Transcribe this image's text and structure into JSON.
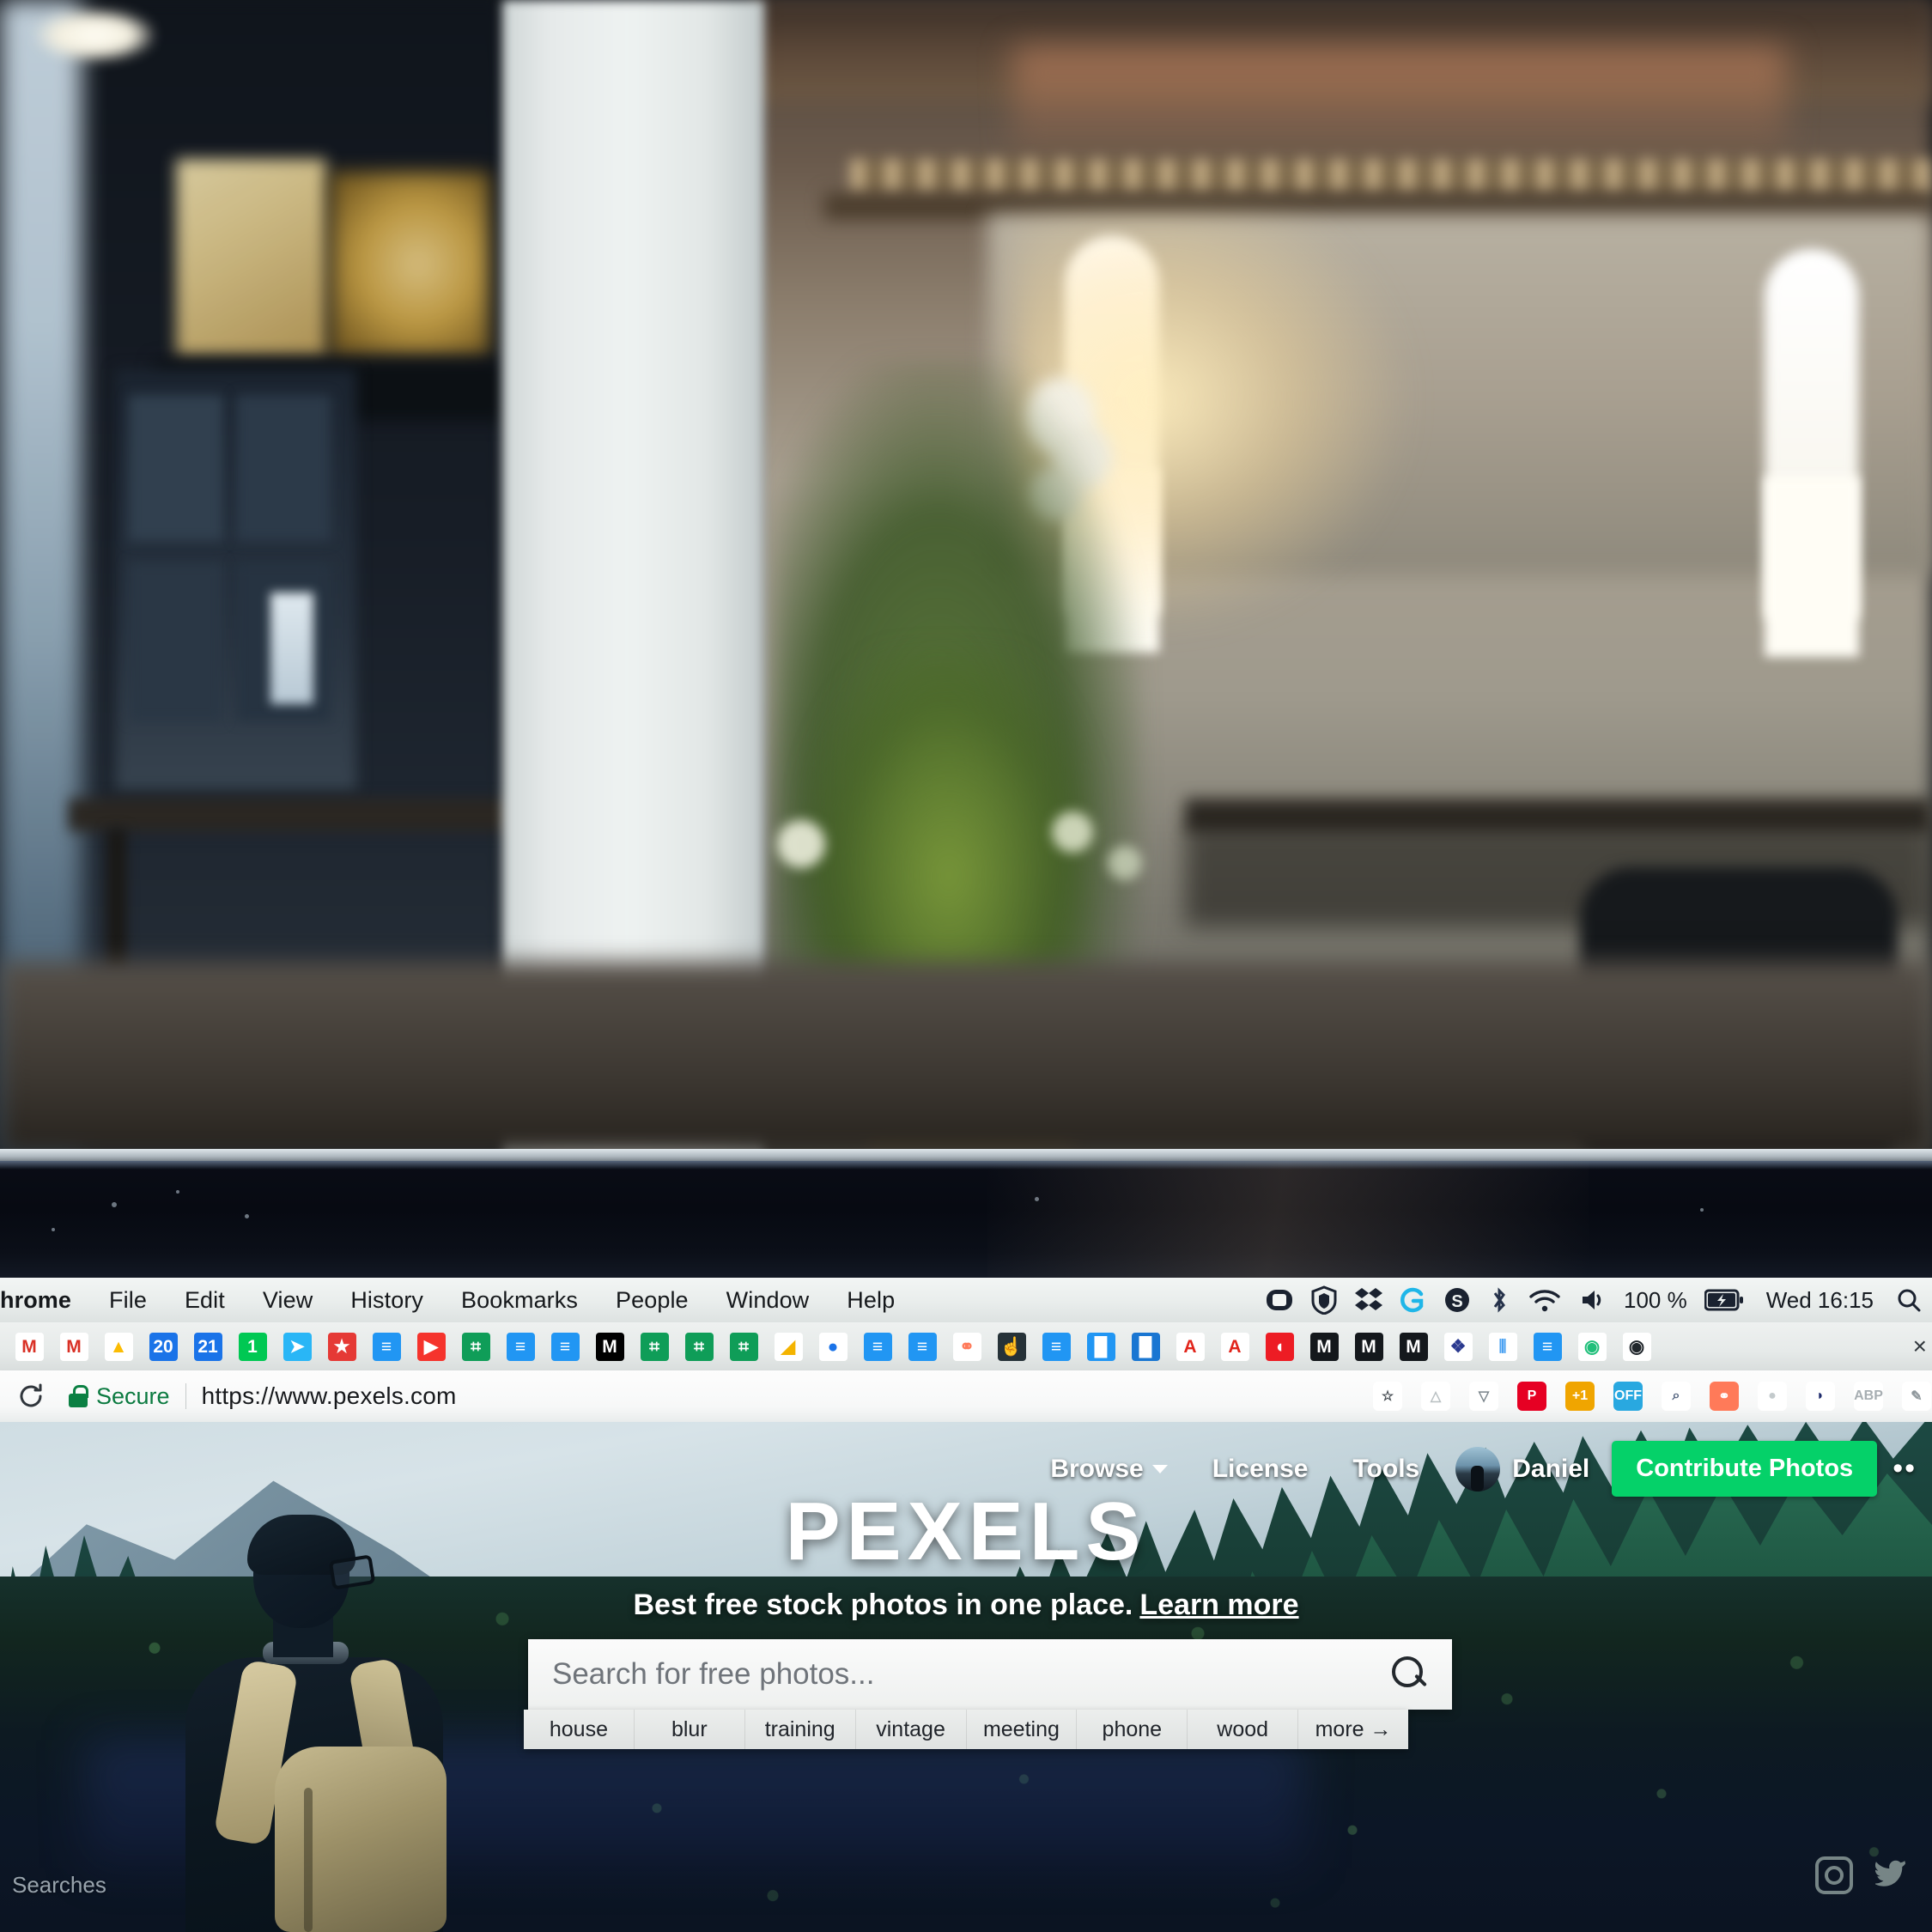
{
  "menubar": {
    "items": [
      "hrome",
      "File",
      "Edit",
      "View",
      "History",
      "Bookmarks",
      "People",
      "Window",
      "Help"
    ],
    "status": {
      "icons": [
        "display-icon",
        "vpn-shield-icon",
        "dropbox-icon",
        "logitech-g-icon",
        "skype-icon",
        "bluetooth-icon",
        "wifi-icon",
        "volume-icon"
      ],
      "battery_percent": "100 %",
      "battery_icon": "battery-charging-icon",
      "clock": "Wed 16:15",
      "spotlight_icon": "search-icon"
    }
  },
  "bookmarks": {
    "items": [
      {
        "name": "gmail",
        "glyph": "M",
        "bg": "#ffffff",
        "fg": "#d93025"
      },
      {
        "name": "gmail-2",
        "glyph": "M",
        "bg": "#ffffff",
        "fg": "#d93025"
      },
      {
        "name": "google-drive",
        "glyph": "▲",
        "bg": "#ffffff",
        "fg": "#fbbc04"
      },
      {
        "name": "google-calendar-20",
        "glyph": "20",
        "bg": "#1a73e8",
        "fg": "#ffffff"
      },
      {
        "name": "google-calendar-21",
        "glyph": "21",
        "bg": "#1a73e8",
        "fg": "#ffffff"
      },
      {
        "name": "evernote",
        "glyph": "1",
        "bg": "#00c853",
        "fg": "#ffffff"
      },
      {
        "name": "telegram",
        "glyph": "➤",
        "bg": "#29b6f6",
        "fg": "#ffffff"
      },
      {
        "name": "pocket-star",
        "glyph": "★",
        "bg": "#e53935",
        "fg": "#ffffff"
      },
      {
        "name": "google-docs",
        "glyph": "≡",
        "bg": "#2196f3",
        "fg": "#ffffff"
      },
      {
        "name": "youtube",
        "glyph": "▶",
        "bg": "#f5332c",
        "fg": "#ffffff"
      },
      {
        "name": "google-sheets",
        "glyph": "⌗",
        "bg": "#0f9d58",
        "fg": "#ffffff"
      },
      {
        "name": "google-docs-2",
        "glyph": "≡",
        "bg": "#2196f3",
        "fg": "#ffffff"
      },
      {
        "name": "google-docs-3",
        "glyph": "≡",
        "bg": "#2196f3",
        "fg": "#ffffff"
      },
      {
        "name": "medium",
        "glyph": "M",
        "bg": "#000000",
        "fg": "#ffffff"
      },
      {
        "name": "google-sheets-2",
        "glyph": "⌗",
        "bg": "#0f9d58",
        "fg": "#ffffff"
      },
      {
        "name": "google-sheets-3",
        "glyph": "⌗",
        "bg": "#0f9d58",
        "fg": "#ffffff"
      },
      {
        "name": "google-sheets-4",
        "glyph": "⌗",
        "bg": "#0f9d58",
        "fg": "#ffffff"
      },
      {
        "name": "analytics-yellow",
        "glyph": "◢",
        "bg": "#ffffff",
        "fg": "#f4b400"
      },
      {
        "name": "search-blue",
        "glyph": "●",
        "bg": "#ffffff",
        "fg": "#1a73e8"
      },
      {
        "name": "google-docs-4",
        "glyph": "≡",
        "bg": "#2196f3",
        "fg": "#ffffff"
      },
      {
        "name": "google-docs-5",
        "glyph": "≡",
        "bg": "#2196f3",
        "fg": "#ffffff"
      },
      {
        "name": "hubspot",
        "glyph": "⚭",
        "bg": "#ffffff",
        "fg": "#ff7a59"
      },
      {
        "name": "cursor-hand",
        "glyph": "☝",
        "bg": "#263238",
        "fg": "#ffffff"
      },
      {
        "name": "google-docs-6",
        "glyph": "≡",
        "bg": "#2196f3",
        "fg": "#ffffff"
      },
      {
        "name": "analytics-blue",
        "glyph": "█",
        "bg": "#2196f3",
        "fg": "#ffffff"
      },
      {
        "name": "analytics-blue-2",
        "glyph": "█",
        "bg": "#1976d2",
        "fg": "#ffffff"
      },
      {
        "name": "adobe-1",
        "glyph": "A",
        "bg": "#ffffff",
        "fg": "#e1251b"
      },
      {
        "name": "adobe-2",
        "glyph": "A",
        "bg": "#ffffff",
        "fg": "#e1251b"
      },
      {
        "name": "adobe-red",
        "glyph": "◖",
        "bg": "#ed1c24",
        "fg": "#ffffff"
      },
      {
        "name": "medium-2",
        "glyph": "M",
        "bg": "#14181c",
        "fg": "#ffffff"
      },
      {
        "name": "medium-3",
        "glyph": "M",
        "bg": "#14181c",
        "fg": "#ffffff"
      },
      {
        "name": "medium-4",
        "glyph": "M",
        "bg": "#14181c",
        "fg": "#ffffff"
      },
      {
        "name": "bird-blue",
        "glyph": "❖",
        "bg": "#ffffff",
        "fg": "#2b3a8f"
      },
      {
        "name": "steemit",
        "glyph": "⦀",
        "bg": "#ffffff",
        "fg": "#4ba2f2"
      },
      {
        "name": "google-docs-7",
        "glyph": "≡",
        "bg": "#2196f3",
        "fg": "#ffffff"
      },
      {
        "name": "aperture-green",
        "glyph": "◉",
        "bg": "#ffffff",
        "fg": "#1fbf7a"
      },
      {
        "name": "aperture-dark",
        "glyph": "◉",
        "bg": "#ffffff",
        "fg": "#20262b"
      }
    ],
    "overflow_label": "×"
  },
  "urlbar": {
    "reload_icon": "reload-icon",
    "security_label": "Secure",
    "url": "https://www.pexels.com",
    "extensions": [
      {
        "name": "bookmark-star-icon",
        "glyph": "☆",
        "bg": "#ffffff",
        "fg": "#40474d"
      },
      {
        "name": "google-drive-extension",
        "glyph": "△",
        "bg": "#ffffff",
        "fg": "#b9c0c2"
      },
      {
        "name": "pocket-extension",
        "glyph": "▽",
        "bg": "#ffffff",
        "fg": "#7b858c"
      },
      {
        "name": "pinterest-extension",
        "glyph": "P",
        "bg": "#e60023",
        "fg": "#ffffff"
      },
      {
        "name": "plus-one-badge",
        "glyph": "+1",
        "bg": "#f0a500",
        "fg": "#ffffff"
      },
      {
        "name": "off-toggle-badge",
        "glyph": "OFF",
        "bg": "#29a8e0",
        "fg": "#ffffff"
      },
      {
        "name": "magnifier-extension",
        "glyph": "⌕",
        "bg": "#ffffff",
        "fg": "#4a5b78"
      },
      {
        "name": "hubspot-extension",
        "glyph": "⚭",
        "bg": "#ff7a59",
        "fg": "#ffffff"
      },
      {
        "name": "droplet-gray-extension",
        "glyph": "●",
        "bg": "#ffffff",
        "fg": "#c3cacc"
      },
      {
        "name": "droplet-blue-extension",
        "glyph": "◗",
        "bg": "#ffffff",
        "fg": "#1d2a6b"
      },
      {
        "name": "adblock-plus-extension",
        "glyph": "ABP",
        "bg": "#ffffff",
        "fg": "#a7aeb2"
      },
      {
        "name": "notes-pencil-extension",
        "glyph": "✎",
        "bg": "#ffffff",
        "fg": "#8f979c"
      }
    ]
  },
  "site": {
    "nav": [
      {
        "name": "browse",
        "label": "Browse",
        "has_caret": true
      },
      {
        "name": "license",
        "label": "License",
        "has_caret": false
      },
      {
        "name": "tools",
        "label": "Tools",
        "has_caret": false
      }
    ],
    "user_name": "Daniel",
    "contribute_label": "Contribute Photos",
    "overflow_label": "••",
    "brand": "PEXELS",
    "tagline": "Best free stock photos in one place.",
    "learn_more": "Learn more",
    "search_placeholder": "Search for free photos...",
    "search_value": "",
    "search_icon": "search-icon",
    "tags": [
      "house",
      "blur",
      "training",
      "vintage",
      "meeting",
      "phone",
      "wood",
      "more →"
    ],
    "footer_label": "Searches",
    "social": [
      "instagram-icon",
      "twitter-icon"
    ],
    "accent_green": "#05d169"
  }
}
